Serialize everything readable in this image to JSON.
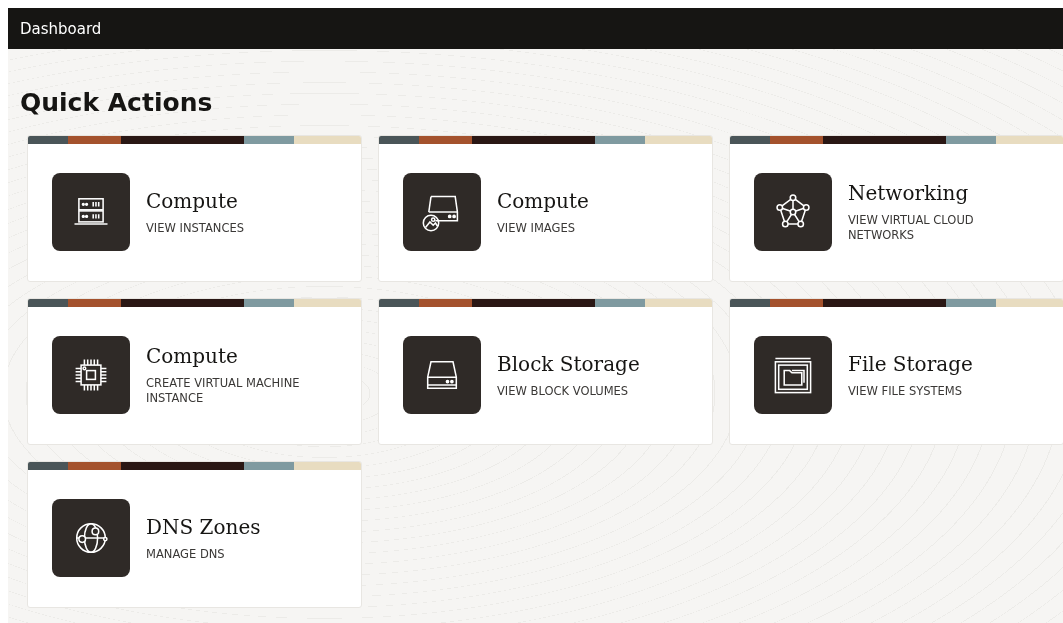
{
  "header": {
    "title": "Dashboard"
  },
  "page_title": "Quick Actions",
  "cards": [
    {
      "title": "Compute",
      "subtitle": "VIEW INSTANCES"
    },
    {
      "title": "Compute",
      "subtitle": "VIEW IMAGES"
    },
    {
      "title": "Networking",
      "subtitle": "VIEW VIRTUAL CLOUD NETWORKS"
    },
    {
      "title": "Compute",
      "subtitle": "CREATE VIRTUAL MACHINE INSTANCE"
    },
    {
      "title": "Block Storage",
      "subtitle": "VIEW BLOCK VOLUMES"
    },
    {
      "title": "File Storage",
      "subtitle": "VIEW FILE SYSTEMS"
    },
    {
      "title": "DNS Zones",
      "subtitle": "MANAGE DNS"
    }
  ]
}
